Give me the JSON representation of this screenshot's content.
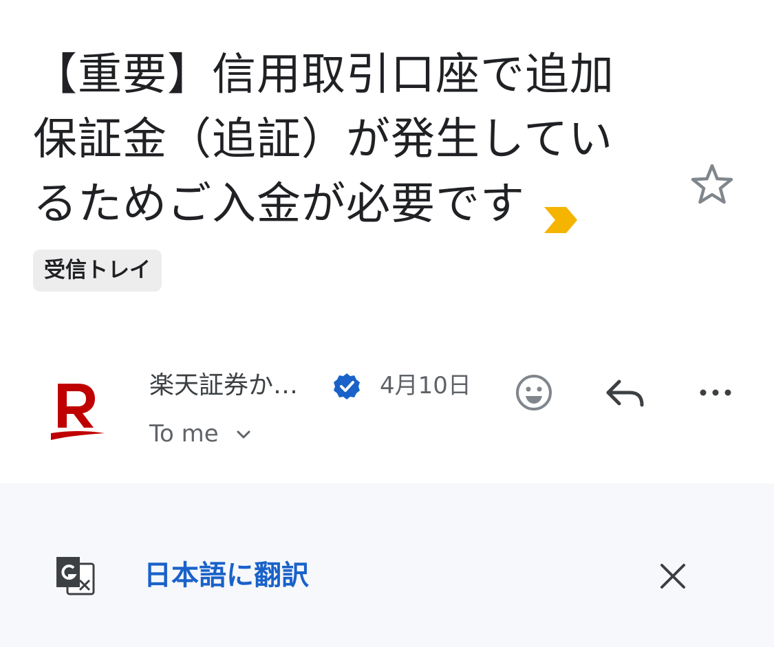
{
  "email": {
    "subject": "【重要】信用取引口座で追加保証金（追証）が発生しているためご入金が必要です",
    "label": "受信トレイ",
    "sender": "楽天証券か…",
    "date": "4月10日",
    "recipient": "To me"
  },
  "translate": {
    "link_label": "日本語に翻訳"
  },
  "icons": {
    "importance": "importance-marker-icon",
    "star": "star-outline-icon",
    "avatar": "rakuten-logo",
    "verified": "verified-badge-icon",
    "recipient_toggle": "chevron-down-icon",
    "emoji": "smiley-icon",
    "reply": "reply-icon",
    "more": "more-horizontal-icon",
    "translate": "google-translate-icon",
    "close": "close-icon"
  },
  "colors": {
    "importance": "#f4b400",
    "avatar_brand": "#bf0000",
    "verified": "#1a62c9",
    "link": "#1a62c9",
    "translate_bar_bg": "#f7f8fc"
  }
}
